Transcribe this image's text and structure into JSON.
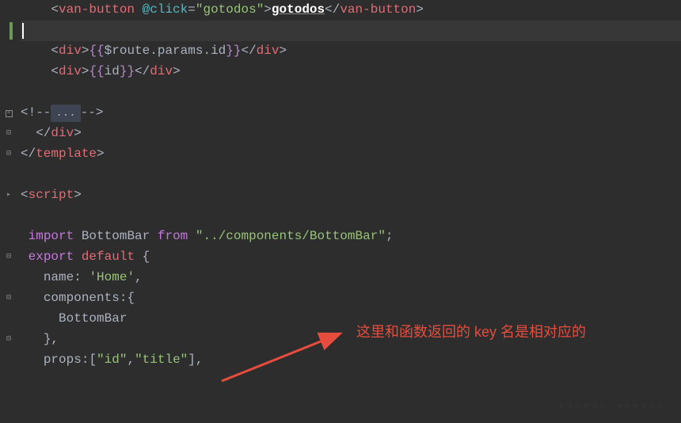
{
  "code": {
    "l1": {
      "indent": "    ",
      "tag": "van-button",
      "attr": "@click",
      "val": "gotodos",
      "content": "gotodos"
    },
    "l3": {
      "indent": "    ",
      "tag": "div",
      "expr_open": "{{",
      "expr_close": "}}",
      "expr": "$route.params.id"
    },
    "l4": {
      "indent": "    ",
      "tag": "div",
      "expr_open": "{{",
      "expr_close": "}}",
      "expr": "id"
    },
    "l6": {
      "comment_open": "<!--",
      "dots": "...",
      "comment_close": "-->"
    },
    "l7": {
      "indent": "  ",
      "tag": "div"
    },
    "l8": {
      "tag": "template"
    },
    "l10": {
      "tag": "script"
    },
    "l12": {
      "kw": "import",
      "name": "BottomBar",
      "from": "from",
      "path": "\"../components/BottomBar\"",
      "semi": ";"
    },
    "l13": {
      "kw1": "export",
      "kw2": "default",
      "brace": "{"
    },
    "l14": {
      "indent": "  ",
      "key": "name",
      "colon": ":",
      "val": "'Home'",
      "comma": ","
    },
    "l15": {
      "indent": "  ",
      "key": "components",
      "colon": ":",
      "brace": "{"
    },
    "l16": {
      "indent": "    ",
      "name": "BottomBar"
    },
    "l17": {
      "indent": "  ",
      "brace": "}",
      "comma": ","
    },
    "l18": {
      "indent": "  ",
      "key": "props",
      "colon": ":",
      "bracket_open": "[",
      "v1": "\"id\"",
      "comma": ",",
      "v2": "\"title\"",
      "bracket_close": "]",
      "end": ","
    }
  },
  "annotation": {
    "text": "这里和函数返回的 key 名是相对应的"
  },
  "watermark": "······ ······"
}
